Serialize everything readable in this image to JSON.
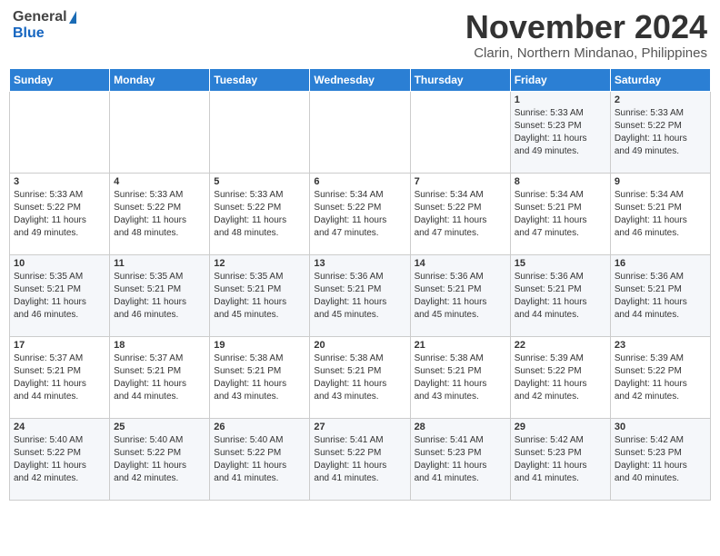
{
  "header": {
    "logo_general": "General",
    "logo_blue": "Blue",
    "month_title": "November 2024",
    "location": "Clarin, Northern Mindanao, Philippines"
  },
  "days_of_week": [
    "Sunday",
    "Monday",
    "Tuesday",
    "Wednesday",
    "Thursday",
    "Friday",
    "Saturday"
  ],
  "weeks": [
    [
      {
        "day": "",
        "info": ""
      },
      {
        "day": "",
        "info": ""
      },
      {
        "day": "",
        "info": ""
      },
      {
        "day": "",
        "info": ""
      },
      {
        "day": "",
        "info": ""
      },
      {
        "day": "1",
        "info": "Sunrise: 5:33 AM\nSunset: 5:23 PM\nDaylight: 11 hours\nand 49 minutes."
      },
      {
        "day": "2",
        "info": "Sunrise: 5:33 AM\nSunset: 5:22 PM\nDaylight: 11 hours\nand 49 minutes."
      }
    ],
    [
      {
        "day": "3",
        "info": "Sunrise: 5:33 AM\nSunset: 5:22 PM\nDaylight: 11 hours\nand 49 minutes."
      },
      {
        "day": "4",
        "info": "Sunrise: 5:33 AM\nSunset: 5:22 PM\nDaylight: 11 hours\nand 48 minutes."
      },
      {
        "day": "5",
        "info": "Sunrise: 5:33 AM\nSunset: 5:22 PM\nDaylight: 11 hours\nand 48 minutes."
      },
      {
        "day": "6",
        "info": "Sunrise: 5:34 AM\nSunset: 5:22 PM\nDaylight: 11 hours\nand 47 minutes."
      },
      {
        "day": "7",
        "info": "Sunrise: 5:34 AM\nSunset: 5:22 PM\nDaylight: 11 hours\nand 47 minutes."
      },
      {
        "day": "8",
        "info": "Sunrise: 5:34 AM\nSunset: 5:21 PM\nDaylight: 11 hours\nand 47 minutes."
      },
      {
        "day": "9",
        "info": "Sunrise: 5:34 AM\nSunset: 5:21 PM\nDaylight: 11 hours\nand 46 minutes."
      }
    ],
    [
      {
        "day": "10",
        "info": "Sunrise: 5:35 AM\nSunset: 5:21 PM\nDaylight: 11 hours\nand 46 minutes."
      },
      {
        "day": "11",
        "info": "Sunrise: 5:35 AM\nSunset: 5:21 PM\nDaylight: 11 hours\nand 46 minutes."
      },
      {
        "day": "12",
        "info": "Sunrise: 5:35 AM\nSunset: 5:21 PM\nDaylight: 11 hours\nand 45 minutes."
      },
      {
        "day": "13",
        "info": "Sunrise: 5:36 AM\nSunset: 5:21 PM\nDaylight: 11 hours\nand 45 minutes."
      },
      {
        "day": "14",
        "info": "Sunrise: 5:36 AM\nSunset: 5:21 PM\nDaylight: 11 hours\nand 45 minutes."
      },
      {
        "day": "15",
        "info": "Sunrise: 5:36 AM\nSunset: 5:21 PM\nDaylight: 11 hours\nand 44 minutes."
      },
      {
        "day": "16",
        "info": "Sunrise: 5:36 AM\nSunset: 5:21 PM\nDaylight: 11 hours\nand 44 minutes."
      }
    ],
    [
      {
        "day": "17",
        "info": "Sunrise: 5:37 AM\nSunset: 5:21 PM\nDaylight: 11 hours\nand 44 minutes."
      },
      {
        "day": "18",
        "info": "Sunrise: 5:37 AM\nSunset: 5:21 PM\nDaylight: 11 hours\nand 44 minutes."
      },
      {
        "day": "19",
        "info": "Sunrise: 5:38 AM\nSunset: 5:21 PM\nDaylight: 11 hours\nand 43 minutes."
      },
      {
        "day": "20",
        "info": "Sunrise: 5:38 AM\nSunset: 5:21 PM\nDaylight: 11 hours\nand 43 minutes."
      },
      {
        "day": "21",
        "info": "Sunrise: 5:38 AM\nSunset: 5:21 PM\nDaylight: 11 hours\nand 43 minutes."
      },
      {
        "day": "22",
        "info": "Sunrise: 5:39 AM\nSunset: 5:22 PM\nDaylight: 11 hours\nand 42 minutes."
      },
      {
        "day": "23",
        "info": "Sunrise: 5:39 AM\nSunset: 5:22 PM\nDaylight: 11 hours\nand 42 minutes."
      }
    ],
    [
      {
        "day": "24",
        "info": "Sunrise: 5:40 AM\nSunset: 5:22 PM\nDaylight: 11 hours\nand 42 minutes."
      },
      {
        "day": "25",
        "info": "Sunrise: 5:40 AM\nSunset: 5:22 PM\nDaylight: 11 hours\nand 42 minutes."
      },
      {
        "day": "26",
        "info": "Sunrise: 5:40 AM\nSunset: 5:22 PM\nDaylight: 11 hours\nand 41 minutes."
      },
      {
        "day": "27",
        "info": "Sunrise: 5:41 AM\nSunset: 5:22 PM\nDaylight: 11 hours\nand 41 minutes."
      },
      {
        "day": "28",
        "info": "Sunrise: 5:41 AM\nSunset: 5:23 PM\nDaylight: 11 hours\nand 41 minutes."
      },
      {
        "day": "29",
        "info": "Sunrise: 5:42 AM\nSunset: 5:23 PM\nDaylight: 11 hours\nand 41 minutes."
      },
      {
        "day": "30",
        "info": "Sunrise: 5:42 AM\nSunset: 5:23 PM\nDaylight: 11 hours\nand 40 minutes."
      }
    ]
  ]
}
